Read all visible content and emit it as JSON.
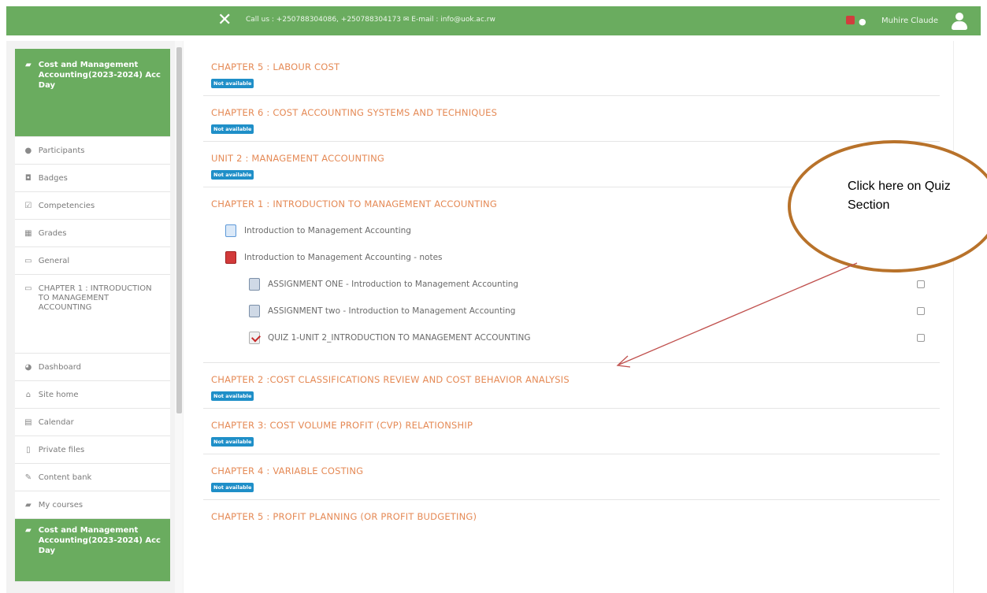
{
  "topbar": {
    "contact": "Call us : +250788304086, +250788304173 ✉ E-mail : info@uok.ac.rw",
    "username": "Muhire Claude",
    "background": "#6aac5f"
  },
  "sidebar": {
    "items": [
      {
        "label": "Cost and Management Accounting(2023-2024) Acc Day",
        "icon": "graduation-cap-icon"
      },
      {
        "label": "Participants",
        "icon": "users-icon"
      },
      {
        "label": "Badges",
        "icon": "badge-icon"
      },
      {
        "label": "Competencies",
        "icon": "competencies-icon"
      },
      {
        "label": "Grades",
        "icon": "grades-icon"
      },
      {
        "label": "General",
        "icon": "folder-icon"
      },
      {
        "label": "CHAPTER 1 : INTRODUCTION TO MANAGEMENT ACCOUNTING",
        "icon": "folder-icon"
      },
      {
        "label": "Dashboard",
        "icon": "dashboard-icon"
      },
      {
        "label": "Site home",
        "icon": "home-icon"
      },
      {
        "label": "Calendar",
        "icon": "calendar-icon"
      },
      {
        "label": "Private files",
        "icon": "file-icon"
      },
      {
        "label": "Content bank",
        "icon": "pencil-icon"
      },
      {
        "label": "My courses",
        "icon": "graduation-cap-icon"
      },
      {
        "label": "Cost and Management Accounting(2023-2024) Acc Day",
        "icon": "graduation-cap-icon"
      }
    ]
  },
  "sections": [
    {
      "title": "CHAPTER 5 : LABOUR COST",
      "badge": "Not available"
    },
    {
      "title": "CHAPTER 6 : COST ACCOUNTING SYSTEMS AND TECHNIQUES",
      "badge": "Not available"
    },
    {
      "title": "UNIT 2 : MANAGEMENT ACCOUNTING",
      "badge": "Not available"
    },
    {
      "title": "CHAPTER 1 : INTRODUCTION TO MANAGEMENT ACCOUNTING",
      "activities": [
        {
          "label": "Introduction to Management Accounting",
          "icon": "page-icon"
        },
        {
          "label": "Introduction to Management Accounting - notes",
          "icon": "pdf-file-icon"
        },
        {
          "label": "ASSIGNMENT ONE - Introduction to Management Accounting",
          "icon": "assignment-icon"
        },
        {
          "label": "ASSIGNMENT two - Introduction to Management Accounting",
          "icon": "assignment-icon"
        },
        {
          "label": "QUIZ 1-UNIT 2_INTRODUCTION TO MANAGEMENT ACCOUNTING",
          "icon": "quiz-icon"
        }
      ]
    },
    {
      "title": "CHAPTER 2 :COST CLASSIFICATIONS REVIEW AND COST BEHAVIOR ANALYSIS",
      "badge": "Not available"
    },
    {
      "title": "CHAPTER 3: COST VOLUME PROFIT (CVP) RELATIONSHIP",
      "badge": "Not available"
    },
    {
      "title": "CHAPTER 4 : VARIABLE COSTING",
      "badge": "Not available"
    },
    {
      "title": "CHAPTER 5 : PROFIT PLANNING (OR PROFIT BUDGETING)"
    }
  ],
  "annotation": {
    "text": "Click here on Quiz Section",
    "ellipse_color": "#b8722a",
    "arrow_color": "#c0504d"
  },
  "colors": {
    "accent": "#6aac5f",
    "section_title": "#e58a56",
    "badge": "#1f8fc8"
  }
}
